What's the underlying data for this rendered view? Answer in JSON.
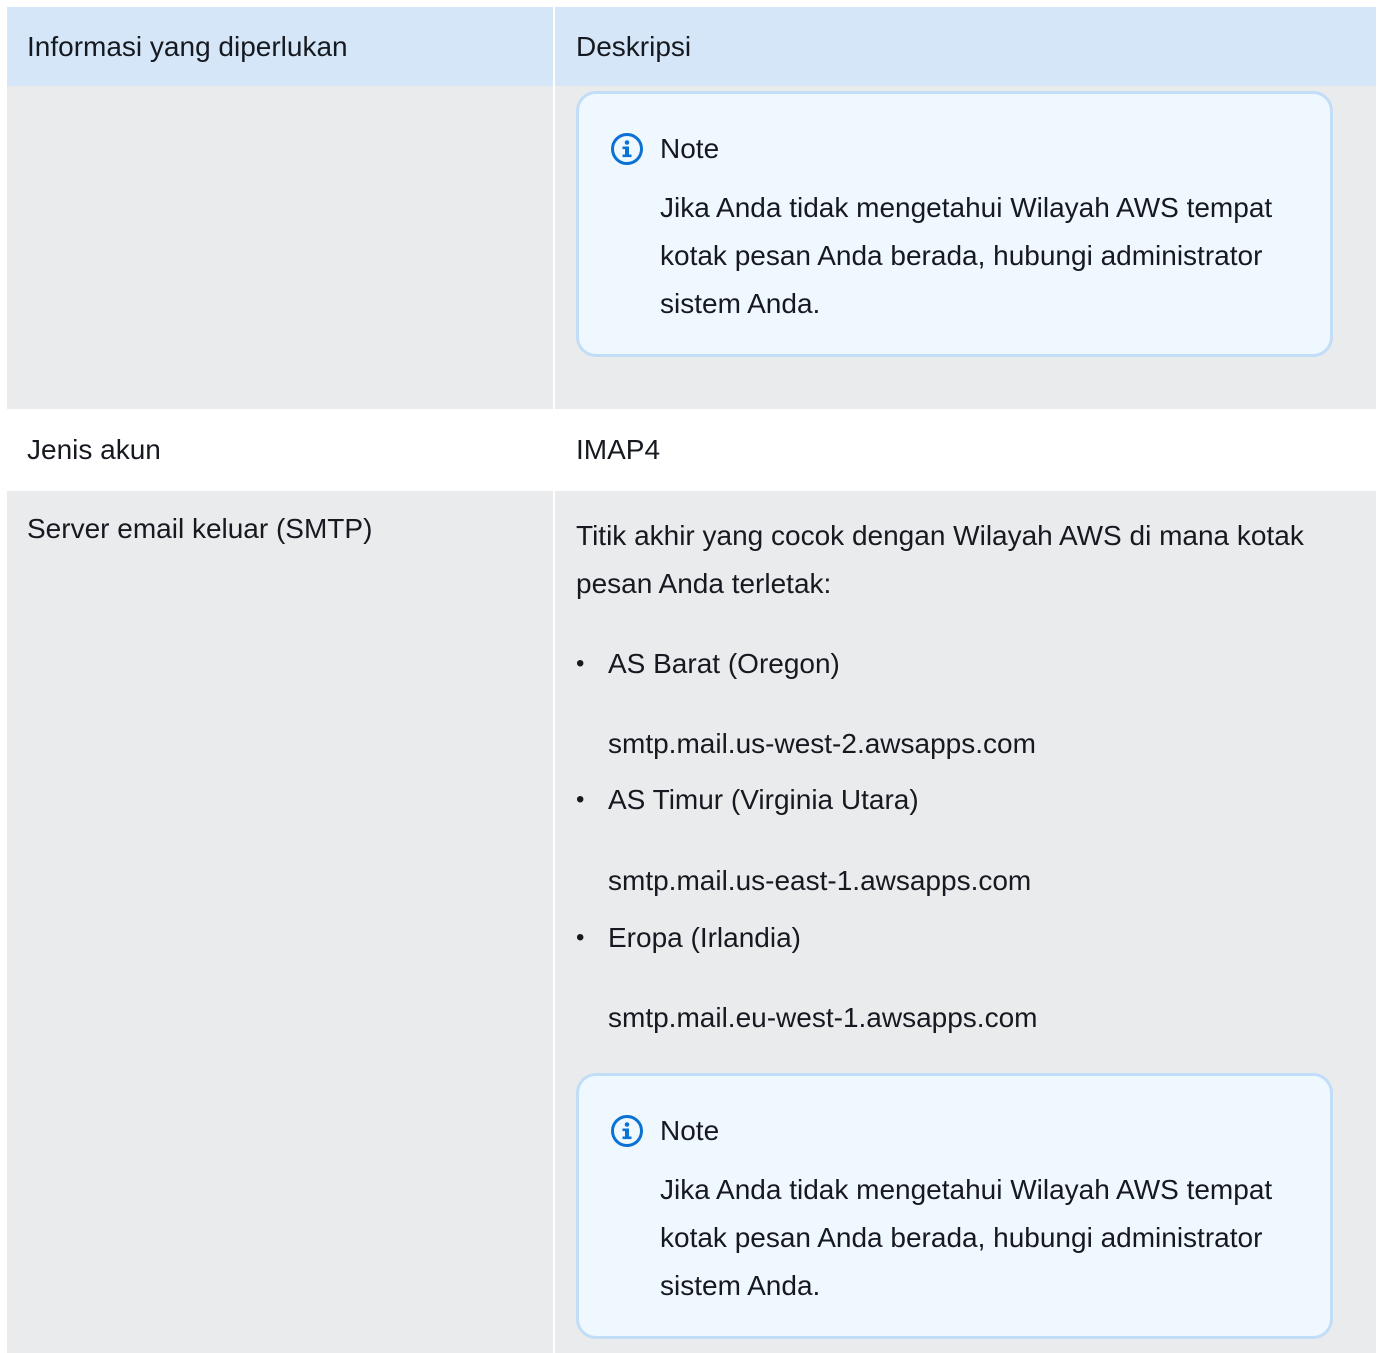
{
  "table": {
    "header": {
      "col1": "Informasi yang diperlukan",
      "col2": "Deskripsi"
    },
    "rows": {
      "region_note": {
        "note_title": "Note",
        "note_text": "Jika Anda tidak mengetahui Wilayah AWS tempat kotak pesan Anda berada, hubungi administrator sistem Anda."
      },
      "account_type": {
        "label": "Jenis akun",
        "value": "IMAP4"
      },
      "smtp": {
        "label": "Server email keluar (SMTP)",
        "intro": "Titik akhir yang cocok dengan Wilayah AWS di mana kotak pesan Anda terletak:",
        "regions": [
          {
            "name": "AS Barat (Oregon)",
            "endpoint": "smtp.mail.us-west-2.awsapps.com"
          },
          {
            "name": "AS Timur (Virginia Utara)",
            "endpoint": "smtp.mail.us-east-1.awsapps.com"
          },
          {
            "name": "Eropa (Irlandia)",
            "endpoint": "smtp.mail.eu-west-1.awsapps.com"
          }
        ],
        "bullet": "•",
        "note_title": "Note",
        "note_text": "Jika Anda tidak mengetahui Wilayah AWS tempat kotak pesan Anda berada, hubungi administrator sistem Anda."
      }
    }
  },
  "colors": {
    "header_bg": "#d4e6f8",
    "row_grey": "#e9ebed",
    "note_bg": "#f0f8ff",
    "note_border": "#c2ddf7",
    "info_icon": "#0972d3"
  },
  "icons": {
    "note_icon": "info-circle-icon"
  }
}
